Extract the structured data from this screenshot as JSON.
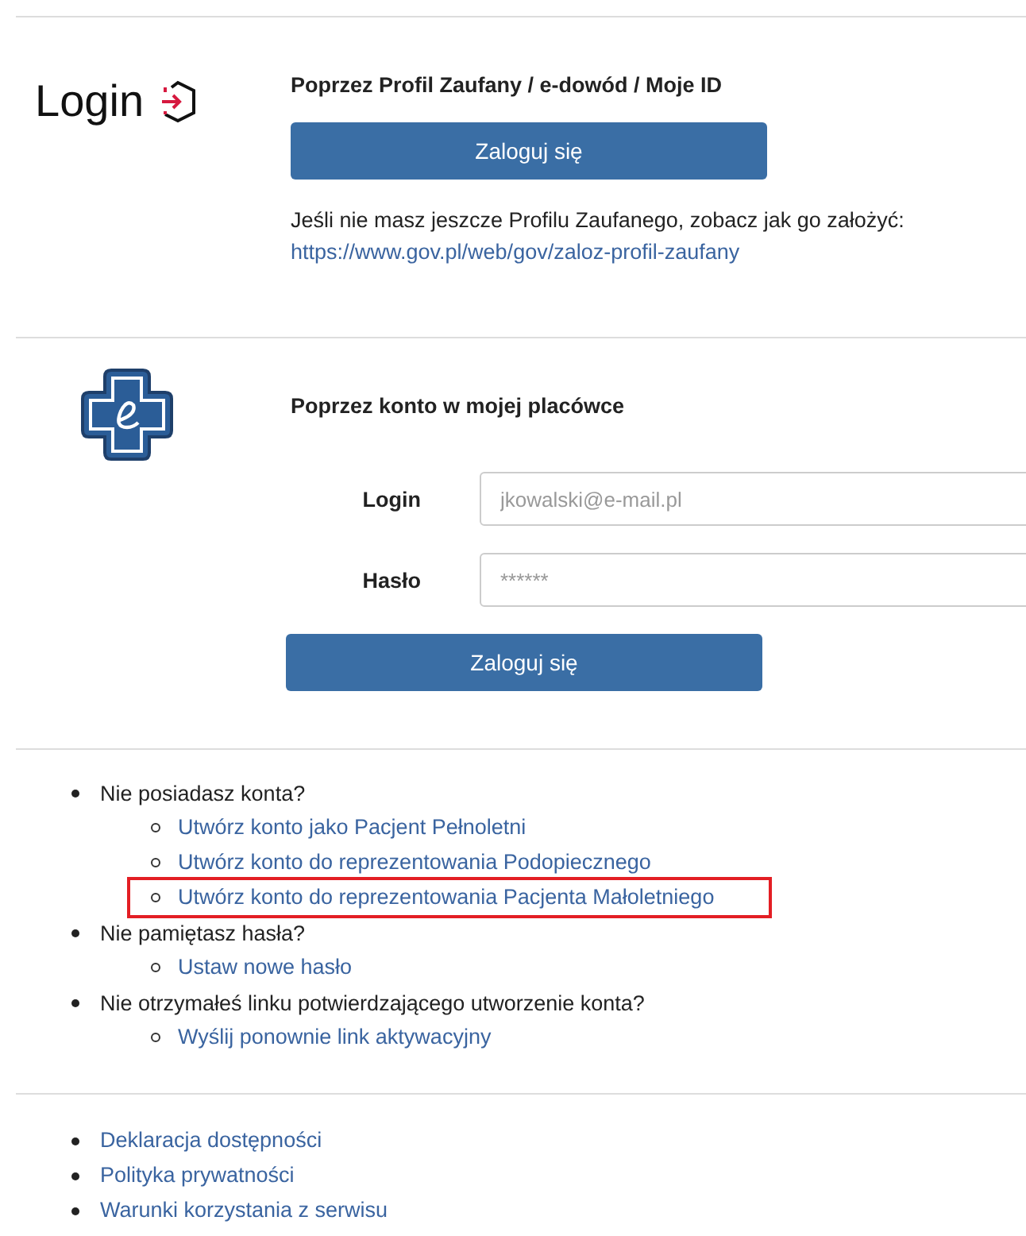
{
  "login_title": "Login",
  "profil_section": {
    "heading": "Poprzez Profil Zaufany / e-dowód / Moje ID",
    "button": "Zaloguj się",
    "info": "Jeśli nie masz jeszcze Profilu Zaufanego, zobacz jak go założyć:",
    "link": "https://www.gov.pl/web/gov/zaloz-profil-zaufany"
  },
  "account_section": {
    "heading": "Poprzez konto w mojej placówce",
    "fields": [
      {
        "label": "Login",
        "placeholder": "jkowalski@e-mail.pl"
      },
      {
        "label": "Hasło",
        "placeholder": "******"
      }
    ],
    "button": "Zaloguj się"
  },
  "help_list": [
    {
      "text": "Nie posiadasz konta?",
      "children": [
        {
          "text": "Utwórz konto jako Pacjent Pełnoletni",
          "highlighted": false
        },
        {
          "text": "Utwórz konto do reprezentowania Podopiecznego",
          "highlighted": false
        },
        {
          "text": "Utwórz konto do reprezentowania Pacjenta Małoletniego",
          "highlighted": true
        }
      ]
    },
    {
      "text": "Nie pamiętasz hasła?",
      "children": [
        {
          "text": "Ustaw nowe hasło",
          "highlighted": false
        }
      ]
    },
    {
      "text": "Nie otrzymałeś linku potwierdzającego utworzenie konta?",
      "children": [
        {
          "text": "Wyślij ponownie link aktywacyjny",
          "highlighted": false
        }
      ]
    }
  ],
  "footer_links": [
    "Deklaracja dostępności",
    "Polityka prywatności",
    "Warunki korzystania z serwisu"
  ]
}
